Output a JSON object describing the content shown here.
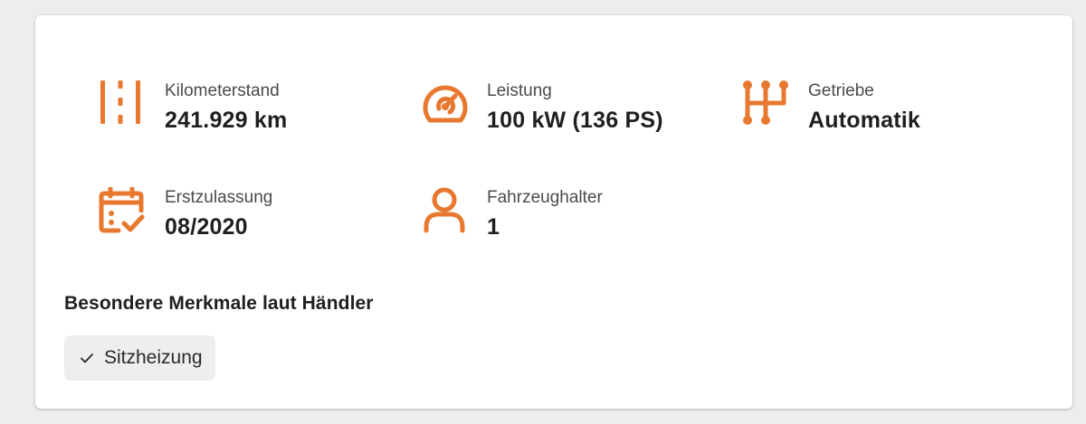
{
  "theme": {
    "accent": "#e8782f",
    "card_background": "#ffffff",
    "page_background": "#eceded",
    "chip_background": "#eceeef"
  },
  "specs": [
    {
      "icon": "road-icon",
      "label": "Kilometerstand",
      "value": "241.929 km"
    },
    {
      "icon": "speedometer-icon",
      "label": "Leistung",
      "value": "100 kW (136 PS)"
    },
    {
      "icon": "gearshift-icon",
      "label": "Getriebe",
      "value": "Automatik"
    },
    {
      "icon": "calendar-check-icon",
      "label": "Erstzulassung",
      "value": "08/2020"
    },
    {
      "icon": "person-icon",
      "label": "Fahrzeughalter",
      "value": "1"
    }
  ],
  "features": {
    "title": "Besondere Merkmale laut Händler",
    "items": [
      {
        "icon": "checkmark-icon",
        "label": "Sitzheizung"
      }
    ]
  }
}
